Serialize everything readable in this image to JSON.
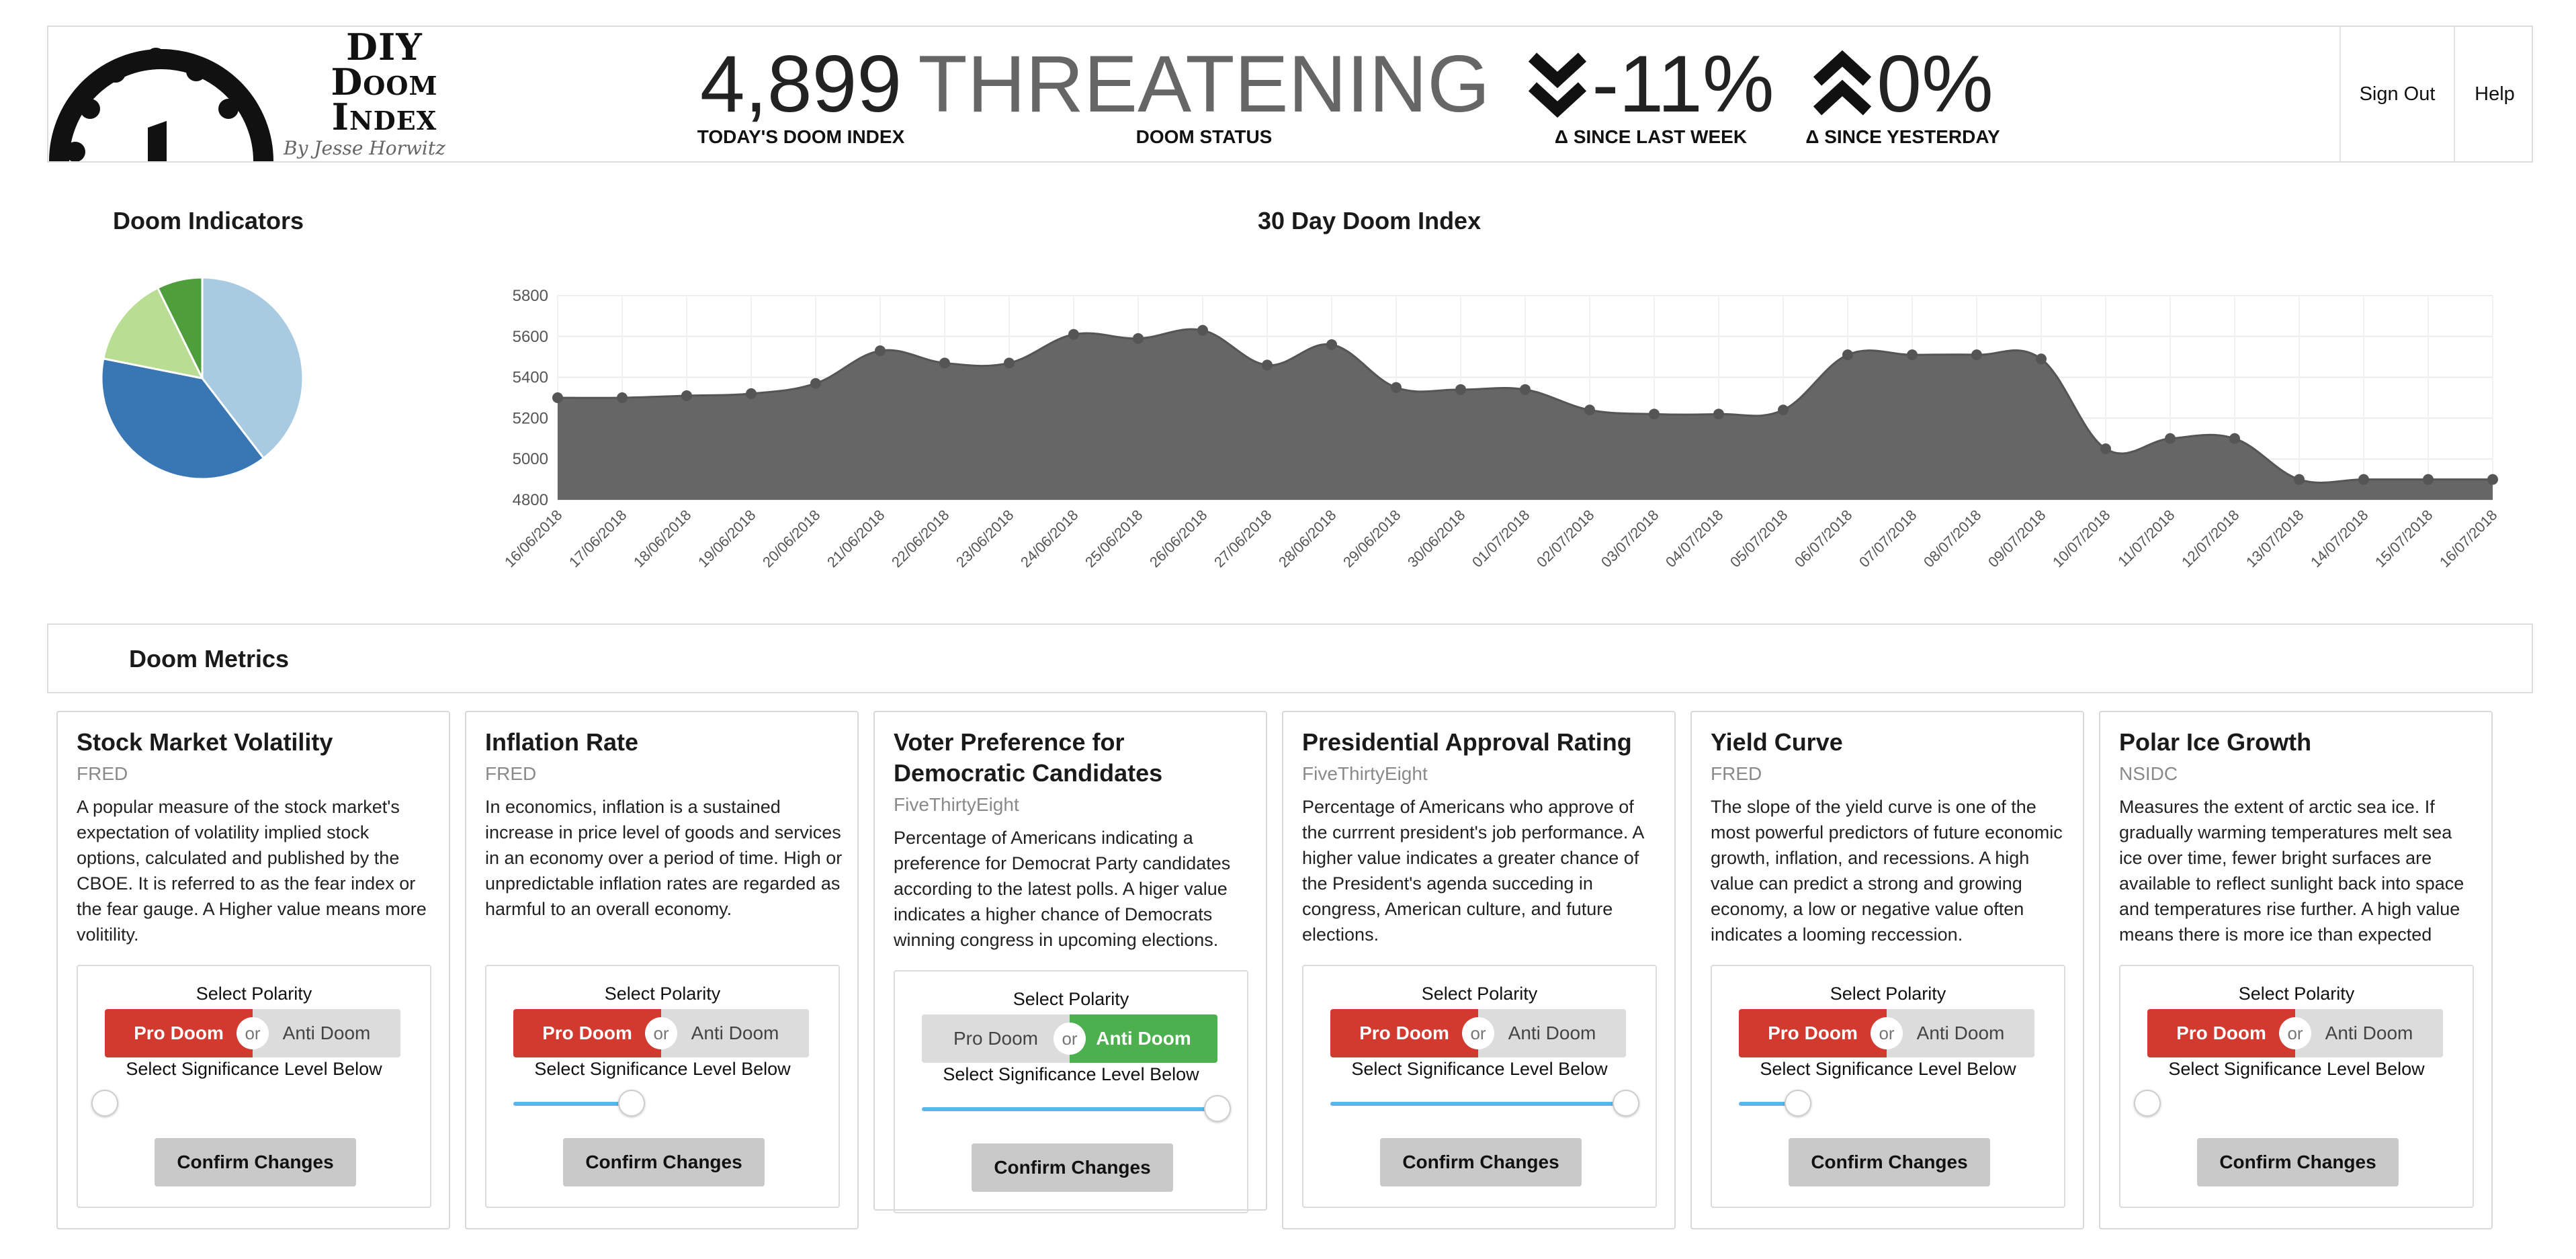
{
  "header": {
    "logo_title_line1": "DIY",
    "logo_title_line2": "Doom",
    "logo_title_line3": "Index",
    "logo_byline": "By Jesse Horwitz",
    "doom_index_value": "4,899",
    "doom_index_label": "TODAY'S DOOM INDEX",
    "doom_status_value": "THREATENING",
    "doom_status_label": "DOOM STATUS",
    "week_change_value": "-11%",
    "week_change_label": "Δ SINCE LAST WEEK",
    "day_change_value": "0%",
    "day_change_label": "Δ SINCE YESTERDAY",
    "sign_out": "Sign Out",
    "help": "Help"
  },
  "indicators": {
    "title": "Doom Indicators",
    "slices": [
      {
        "value": 38,
        "color": "#a9cbe2"
      },
      {
        "value": 37,
        "color": "#3977b4"
      },
      {
        "value": 14,
        "color": "#b9dd93"
      },
      {
        "value": 7,
        "color": "#4f9e3c"
      }
    ]
  },
  "chart_data": [
    {
      "type": "pie",
      "title": "Doom Indicators",
      "values": [
        38,
        37,
        14,
        7
      ],
      "colors": [
        "#a9cbe2",
        "#3977b4",
        "#b9dd93",
        "#4f9e3c"
      ]
    },
    {
      "type": "area",
      "title": "30 Day Doom Index",
      "xlabel": "",
      "ylabel": "",
      "ylim": [
        4800,
        5800
      ],
      "yticks": [
        4800,
        5000,
        5200,
        5400,
        5600,
        5800
      ],
      "grid": true,
      "color": "#666666",
      "x": [
        "16/06/2018",
        "17/06/2018",
        "18/06/2018",
        "19/06/2018",
        "20/06/2018",
        "21/06/2018",
        "22/06/2018",
        "23/06/2018",
        "24/06/2018",
        "25/06/2018",
        "26/06/2018",
        "27/06/2018",
        "28/06/2018",
        "29/06/2018",
        "30/06/2018",
        "01/07/2018",
        "02/07/2018",
        "03/07/2018",
        "04/07/2018",
        "05/07/2018",
        "06/07/2018",
        "07/07/2018",
        "08/07/2018",
        "09/07/2018",
        "10/07/2018",
        "11/07/2018",
        "12/07/2018",
        "13/07/2018",
        "14/07/2018",
        "15/07/2018",
        "16/07/2018"
      ],
      "y": [
        5300,
        5300,
        5310,
        5320,
        5370,
        5530,
        5470,
        5470,
        5610,
        5590,
        5630,
        5460,
        5560,
        5350,
        5340,
        5340,
        5240,
        5220,
        5220,
        5240,
        5510,
        5510,
        5510,
        5490,
        5050,
        5100,
        5100,
        4900,
        4900,
        4900,
        4900
      ]
    }
  ],
  "metrics": {
    "title": "Doom Metrics",
    "labels": {
      "select_polarity": "Select Polarity",
      "pro": "Pro Doom",
      "or": "or",
      "anti": "Anti Doom",
      "significance": "Select Significance Level Below",
      "confirm": "Confirm Changes"
    },
    "cards": [
      {
        "title": "Stock Market Volatility",
        "source": "FRED",
        "description": "A popular measure of the stock market's expectation of volatility implied stock options, calculated and published by the CBOE. It is referred to as the fear index or the fear gauge. A Higher value means more volitility.",
        "polarity": "pro",
        "significance": 0.0
      },
      {
        "title": "Inflation Rate",
        "source": "FRED",
        "description": "In economics, inflation is a sustained increase in price level of goods and services in an economy over a period of time. High or unpredictable inflation rates are regarded as harmful to an overall economy.",
        "polarity": "pro",
        "significance": 0.4
      },
      {
        "title": "Voter Preference for Democratic Candidates",
        "source": "FiveThirtyEight",
        "description": "Percentage of Americans indicating a preference for Democrat Party candidates according to the latest polls. A higer value indicates a higher chance of Democrats winning congress in upcoming elections.",
        "polarity": "anti",
        "significance": 1.0
      },
      {
        "title": "Presidential Approval Rating",
        "source": "FiveThirtyEight",
        "description": "Percentage of Americans who approve of the currrent president's job performance. A higher value indicates a greater chance of the President's agenda succeding in congress, American culture, and future elections.",
        "polarity": "pro",
        "significance": 1.0
      },
      {
        "title": "Yield Curve",
        "source": "FRED",
        "description": "The slope of the yield curve is one of the most powerful predictors of future economic growth, inflation, and recessions. A high value can predict a strong and growing economy, a low or negative value often indicates a looming reccession.",
        "polarity": "pro",
        "significance": 0.2
      },
      {
        "title": "Polar Ice Growth",
        "source": "NSIDC",
        "description": "Measures the extent of arctic sea ice. If gradually warming temperatures melt sea ice over time, fewer bright surfaces are available to reflect sunlight back into space and temperatures rise further. A high value means there is more ice than expected",
        "polarity": "pro",
        "significance": 0.0
      }
    ]
  }
}
